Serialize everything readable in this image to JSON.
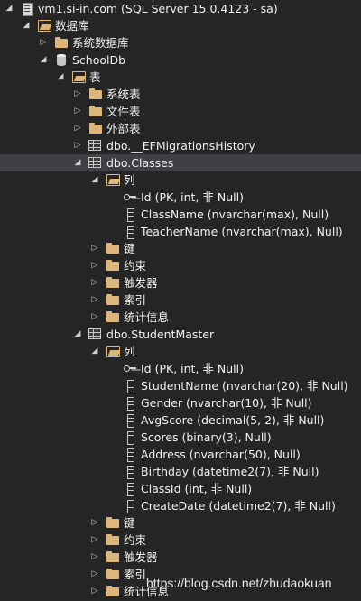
{
  "tree": [
    {
      "depth": 0,
      "exp": "open",
      "icon": "server-icon",
      "label": "vm1.si-in.com (SQL Server 15.0.4123 - sa)"
    },
    {
      "depth": 1,
      "exp": "open",
      "icon": "folder-open-icon",
      "label": "数据库"
    },
    {
      "depth": 2,
      "exp": "closed",
      "icon": "folder-icon",
      "label": "系统数据库"
    },
    {
      "depth": 2,
      "exp": "open",
      "icon": "database-icon",
      "label": "SchoolDb"
    },
    {
      "depth": 3,
      "exp": "open",
      "icon": "folder-open-icon",
      "label": "表"
    },
    {
      "depth": 4,
      "exp": "closed",
      "icon": "folder-icon",
      "label": "系统表"
    },
    {
      "depth": 4,
      "exp": "closed",
      "icon": "folder-icon",
      "label": "文件表"
    },
    {
      "depth": 4,
      "exp": "closed",
      "icon": "folder-icon",
      "label": "外部表"
    },
    {
      "depth": 4,
      "exp": "closed",
      "icon": "table-icon",
      "label": "dbo.__EFMigrationsHistory"
    },
    {
      "depth": 4,
      "exp": "open",
      "icon": "table-icon",
      "label": "dbo.Classes",
      "selected": true
    },
    {
      "depth": 5,
      "exp": "open",
      "icon": "folder-open-icon",
      "label": "列"
    },
    {
      "depth": 6,
      "exp": "none",
      "icon": "key-icon",
      "label": "Id (PK, int, 非 Null)"
    },
    {
      "depth": 6,
      "exp": "none",
      "icon": "column-icon",
      "label": "ClassName (nvarchar(max), Null)"
    },
    {
      "depth": 6,
      "exp": "none",
      "icon": "column-icon",
      "label": "TeacherName (nvarchar(max), Null)"
    },
    {
      "depth": 5,
      "exp": "closed",
      "icon": "folder-icon",
      "label": "键"
    },
    {
      "depth": 5,
      "exp": "closed",
      "icon": "folder-icon",
      "label": "约束"
    },
    {
      "depth": 5,
      "exp": "closed",
      "icon": "folder-icon",
      "label": "触发器"
    },
    {
      "depth": 5,
      "exp": "closed",
      "icon": "folder-icon",
      "label": "索引"
    },
    {
      "depth": 5,
      "exp": "closed",
      "icon": "folder-icon",
      "label": "统计信息"
    },
    {
      "depth": 4,
      "exp": "open",
      "icon": "table-icon",
      "label": "dbo.StudentMaster"
    },
    {
      "depth": 5,
      "exp": "open",
      "icon": "folder-open-icon",
      "label": "列"
    },
    {
      "depth": 6,
      "exp": "none",
      "icon": "key-icon",
      "label": "Id (PK, int, 非 Null)"
    },
    {
      "depth": 6,
      "exp": "none",
      "icon": "column-icon",
      "label": "StudentName (nvarchar(20), 非 Null)"
    },
    {
      "depth": 6,
      "exp": "none",
      "icon": "column-icon",
      "label": "Gender (nvarchar(10), 非 Null)"
    },
    {
      "depth": 6,
      "exp": "none",
      "icon": "column-icon",
      "label": "AvgScore (decimal(5, 2), 非 Null)"
    },
    {
      "depth": 6,
      "exp": "none",
      "icon": "column-icon",
      "label": "Scores (binary(3), Null)"
    },
    {
      "depth": 6,
      "exp": "none",
      "icon": "column-icon",
      "label": "Address (nvarchar(50), Null)"
    },
    {
      "depth": 6,
      "exp": "none",
      "icon": "column-icon",
      "label": "Birthday (datetime2(7), 非 Null)"
    },
    {
      "depth": 6,
      "exp": "none",
      "icon": "column-icon",
      "label": "ClassId (int, 非 Null)"
    },
    {
      "depth": 6,
      "exp": "none",
      "icon": "column-icon",
      "label": "CreateDate (datetime2(7), 非 Null)"
    },
    {
      "depth": 5,
      "exp": "closed",
      "icon": "folder-icon",
      "label": "键"
    },
    {
      "depth": 5,
      "exp": "closed",
      "icon": "folder-icon",
      "label": "约束"
    },
    {
      "depth": 5,
      "exp": "closed",
      "icon": "folder-icon",
      "label": "触发器"
    },
    {
      "depth": 5,
      "exp": "closed",
      "icon": "folder-icon",
      "label": "索引"
    },
    {
      "depth": 5,
      "exp": "closed",
      "icon": "folder-icon",
      "label": "统计信息"
    }
  ],
  "watermark": "https://blog.csdn.net/zhudaokuan",
  "colors": {
    "background": "#252526",
    "selection": "#3f3f46",
    "text": "#f1f1f1",
    "folder": "#dcb67a"
  }
}
